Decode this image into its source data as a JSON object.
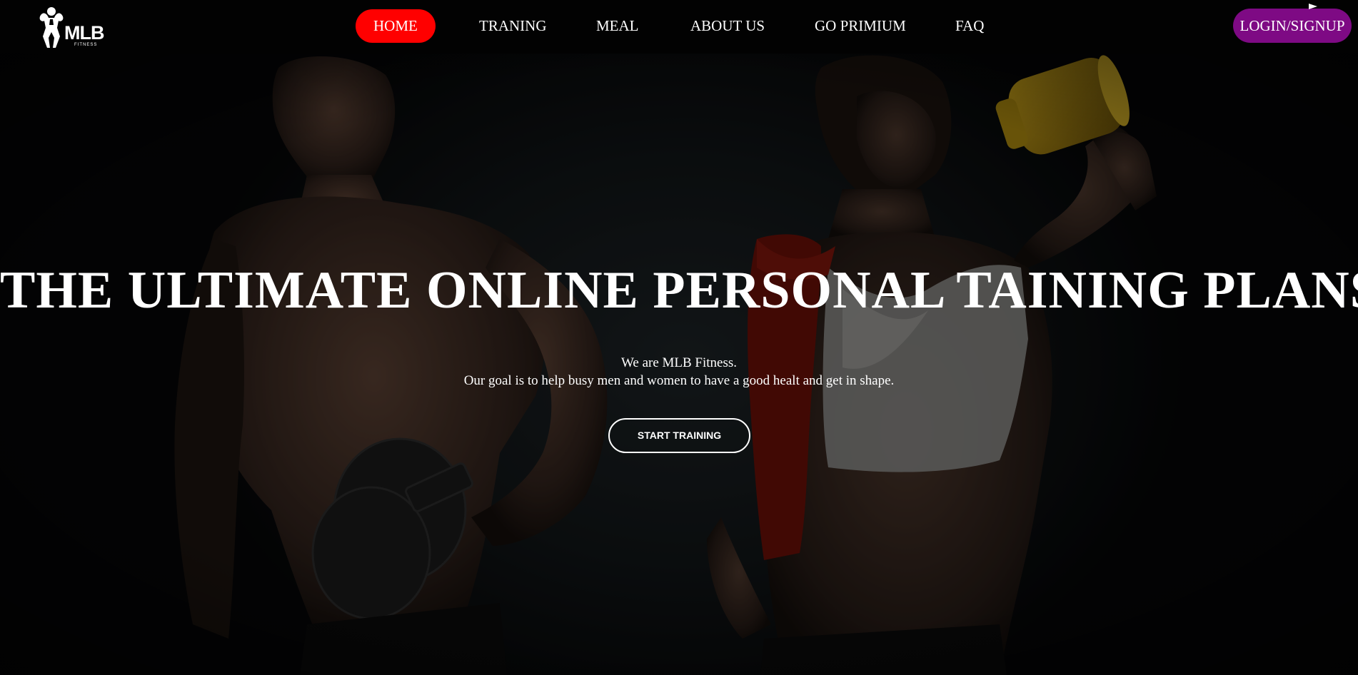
{
  "brand": {
    "logo_text": "MLB",
    "logo_subtext": "FITNESS",
    "logo_icon": "bodybuilder-icon"
  },
  "nav": {
    "items": [
      {
        "label": "HOME",
        "active": true
      },
      {
        "label": "TRANING",
        "active": false
      },
      {
        "label": "MEAL",
        "active": false
      },
      {
        "label": "ABOUT US",
        "active": false
      },
      {
        "label": "GO PRIMIUM",
        "active": false
      },
      {
        "label": "FAQ",
        "active": false
      }
    ],
    "login_label": "LOGIN/SIGNUP"
  },
  "hero": {
    "title": "THE ULTIMATE ONLINE PERSONAL TAINING PLANS",
    "subtitle_line1": "We are MLB Fitness.",
    "subtitle_line2": "Our goal is to help busy men and women to have a good healt and get in shape.",
    "cta_label": "START TRAINING",
    "background": "man with dumbbell and woman drinking from shaker bottle"
  },
  "colors": {
    "header_bg": "#020202",
    "active_nav": "#ff0000",
    "login_bg": "#7e0a84",
    "text": "#ffffff"
  }
}
